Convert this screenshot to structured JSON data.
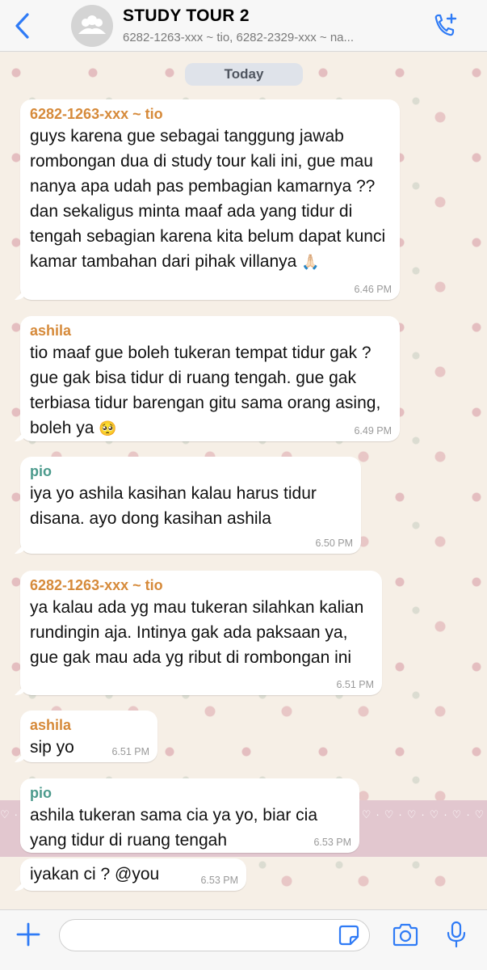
{
  "header": {
    "title": "STUDY TOUR 2",
    "participants": "6282-1263-xxx ~ tio, 6282-2329-xxx ~ na...",
    "back_icon": "chevron-left-icon",
    "call_icon": "phone-plus-icon",
    "avatar_icon": "group-avatar-icon"
  },
  "chat": {
    "day_label": "Today",
    "messages": [
      {
        "sender": "6282-1263-xxx ~ tio",
        "text": "guys karena gue sebagai tanggung jawab rombongan dua di study tour kali ini, gue mau nanya apa udah pas pembagian kamarnya ?? dan sekaligus minta maaf ada yang tidur di tengah sebagian karena kita belum dapat kunci kamar tambahan dari pihak villanya",
        "emoji": "🙏🏻",
        "time": "6.46 PM"
      },
      {
        "sender": "ashila",
        "text": "tio maaf gue boleh tukeran tempat tidur gak ? gue gak bisa tidur di ruang tengah. gue gak terbiasa tidur barengan gitu sama orang asing, boleh ya",
        "emoji": "🥺",
        "time": "6.49 PM"
      },
      {
        "sender": "pio",
        "text": "iya yo ashila kasihan kalau harus tidur disana. ayo dong kasihan ashila",
        "time": "6.50 PM"
      },
      {
        "sender": "6282-1263-xxx ~ tio",
        "text": "ya kalau ada yg mau tukeran silahkan kalian rundingin aja. Intinya gak ada paksaan ya, gue gak mau ada yg ribut di rombongan ini",
        "time": "6.51 PM"
      },
      {
        "sender": "ashila",
        "text": "sip yo",
        "time": "6.51 PM"
      },
      {
        "sender": "pio",
        "text": "ashila tukeran sama cia ya yo, biar cia yang tidur di ruang tengah",
        "time": "6.53 PM"
      },
      {
        "sender": "",
        "text": "iyakan ci ? @you",
        "time": "6.53 PM"
      }
    ]
  },
  "input_bar": {
    "plus_icon": "plus-icon",
    "placeholder": "",
    "sticker_icon": "sticker-icon",
    "camera_icon": "camera-icon",
    "mic_icon": "microphone-icon"
  },
  "colors": {
    "accent": "#2f7bf6",
    "sender_orange": "#d68a3a",
    "sender_teal": "#4b9a8c",
    "bubble": "#ffffff"
  }
}
